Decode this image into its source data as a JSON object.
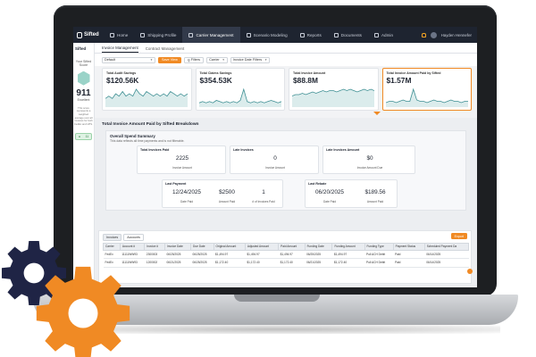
{
  "app": {
    "brand": "Sifted",
    "topnav": {
      "items": [
        {
          "label": "Home",
          "icon": "home-icon",
          "active": false
        },
        {
          "label": "Shipping Profile",
          "icon": "truck-icon",
          "active": false
        },
        {
          "label": "Carrier Management",
          "icon": "box-icon",
          "active": true
        },
        {
          "label": "Scenario Modeling",
          "icon": "flow-icon",
          "active": false
        },
        {
          "label": "Reports",
          "icon": "chart-icon",
          "active": false
        },
        {
          "label": "Documents",
          "icon": "document-icon",
          "active": false
        },
        {
          "label": "Admin",
          "icon": "user-icon",
          "active": false
        }
      ],
      "user_name": "Hayden Hennefer"
    },
    "sidebar": {
      "brand": "Sifted",
      "score_label": "Your Sifted Score",
      "score": "911",
      "grade": "Excellent",
      "note": "This score represents a weighted average over all invoices for both FedEx and UPS.",
      "chip_count": "11"
    },
    "subtabs": [
      "Invoice Management",
      "Contract Management"
    ],
    "filters": {
      "view": "Default",
      "save_view": "Save View",
      "filters": "Filters",
      "carrier": "Carrier",
      "date_filters": "Invoice Date Filters"
    },
    "kpis": [
      {
        "label": "Total Audit Savings",
        "value": "$120.56K"
      },
      {
        "label": "Total Claims Savings",
        "value": "$354.53K"
      },
      {
        "label": "Total Invoice Amount",
        "value": "$88.8M"
      },
      {
        "label": "Total Invoice Amount Paid by Sifted",
        "value": "$1.57M"
      }
    ],
    "section": {
      "title": "Total Invoice Amount Paid by Sifted Breakdown",
      "summary_title": "Overall Spend Summary",
      "summary_note": "This data reflects all time payments and is not filterable.",
      "stats": {
        "invoices_paid": {
          "title": "Total Invoices Paid",
          "value": "2225",
          "caption": "Invoice Amount"
        },
        "late_invoices": {
          "title": "Late Invoices",
          "value": "0",
          "caption": "Invoice Amount"
        },
        "late_amount": {
          "title": "Late Invoices Amount",
          "value": "$0",
          "caption": "Invoice Amount Due"
        },
        "last_payment": {
          "title": "Last Payment",
          "date": "12/24/2025",
          "date_cap": "Date Paid",
          "amount": "$2500",
          "amount_cap": "Amount Paid",
          "count": "1",
          "count_cap": "# of Invoices Paid"
        },
        "last_rebate": {
          "title": "Last Rebate",
          "date": "06/20/2025",
          "date_cap": "Date Paid",
          "amount": "$189.56",
          "amount_cap": "Amount Paid"
        }
      }
    },
    "table": {
      "tabs": [
        "Invoices",
        "Accounts"
      ],
      "export": "Export",
      "columns": [
        "Carrier",
        "Account #",
        "Invoice #",
        "Invoice Date",
        "Due Date",
        "Original Amount",
        "Adjusted Amount",
        "Paid Amount",
        "Funding Date",
        "Funding Amount",
        "Funding Type",
        "Payment Status",
        "Scheduled Payment Da"
      ],
      "rows": [
        [
          "FedEx",
          "11111WW93",
          "2300003",
          "06/25/2025",
          "06/25/2025",
          "$1,494.97",
          "$1,494.97",
          "$1,494.97",
          "06/25/2025",
          "$1,494.97",
          "Pull ACH Debit",
          "Paid",
          "06/14/2025"
        ],
        [
          "FedEx",
          "11111WW93",
          "1200002",
          "06/21/2025",
          "06/25/2025",
          "$1,172.40",
          "$1,172.40",
          "$1,172.40",
          "06/21/2025",
          "$1,172.40",
          "Pull ACH Debit",
          "Paid",
          "06/14/2025"
        ]
      ]
    }
  },
  "colors": {
    "accent": "#f08a24",
    "nav_bg": "#1e2430",
    "gear_dark": "#1f2445",
    "gear_orange": "#f08a24"
  },
  "chart_data": [
    {
      "type": "area",
      "values": [
        3,
        4,
        3,
        5,
        4,
        6,
        4,
        5,
        4,
        7,
        5,
        4,
        6,
        5,
        4,
        5,
        4,
        5,
        4,
        6,
        5,
        4,
        5,
        4,
        5
      ]
    },
    {
      "type": "area",
      "values": [
        2,
        3,
        2,
        3,
        2,
        4,
        3,
        2,
        3,
        2,
        3,
        2,
        4,
        13,
        3,
        2,
        3,
        2,
        3,
        2,
        3,
        4,
        3,
        2,
        3
      ]
    },
    {
      "type": "area",
      "values": [
        7,
        8,
        8,
        9,
        8,
        9,
        10,
        9,
        10,
        11,
        10,
        11,
        11,
        10,
        11,
        12,
        11,
        12,
        11,
        10,
        11,
        12,
        11,
        12,
        11
      ]
    },
    {
      "type": "area",
      "values": [
        2,
        3,
        3,
        2,
        3,
        4,
        3,
        3,
        12,
        4,
        3,
        3,
        2,
        3,
        4,
        3,
        3,
        2,
        3,
        4,
        3,
        3,
        2,
        3,
        3
      ]
    }
  ]
}
